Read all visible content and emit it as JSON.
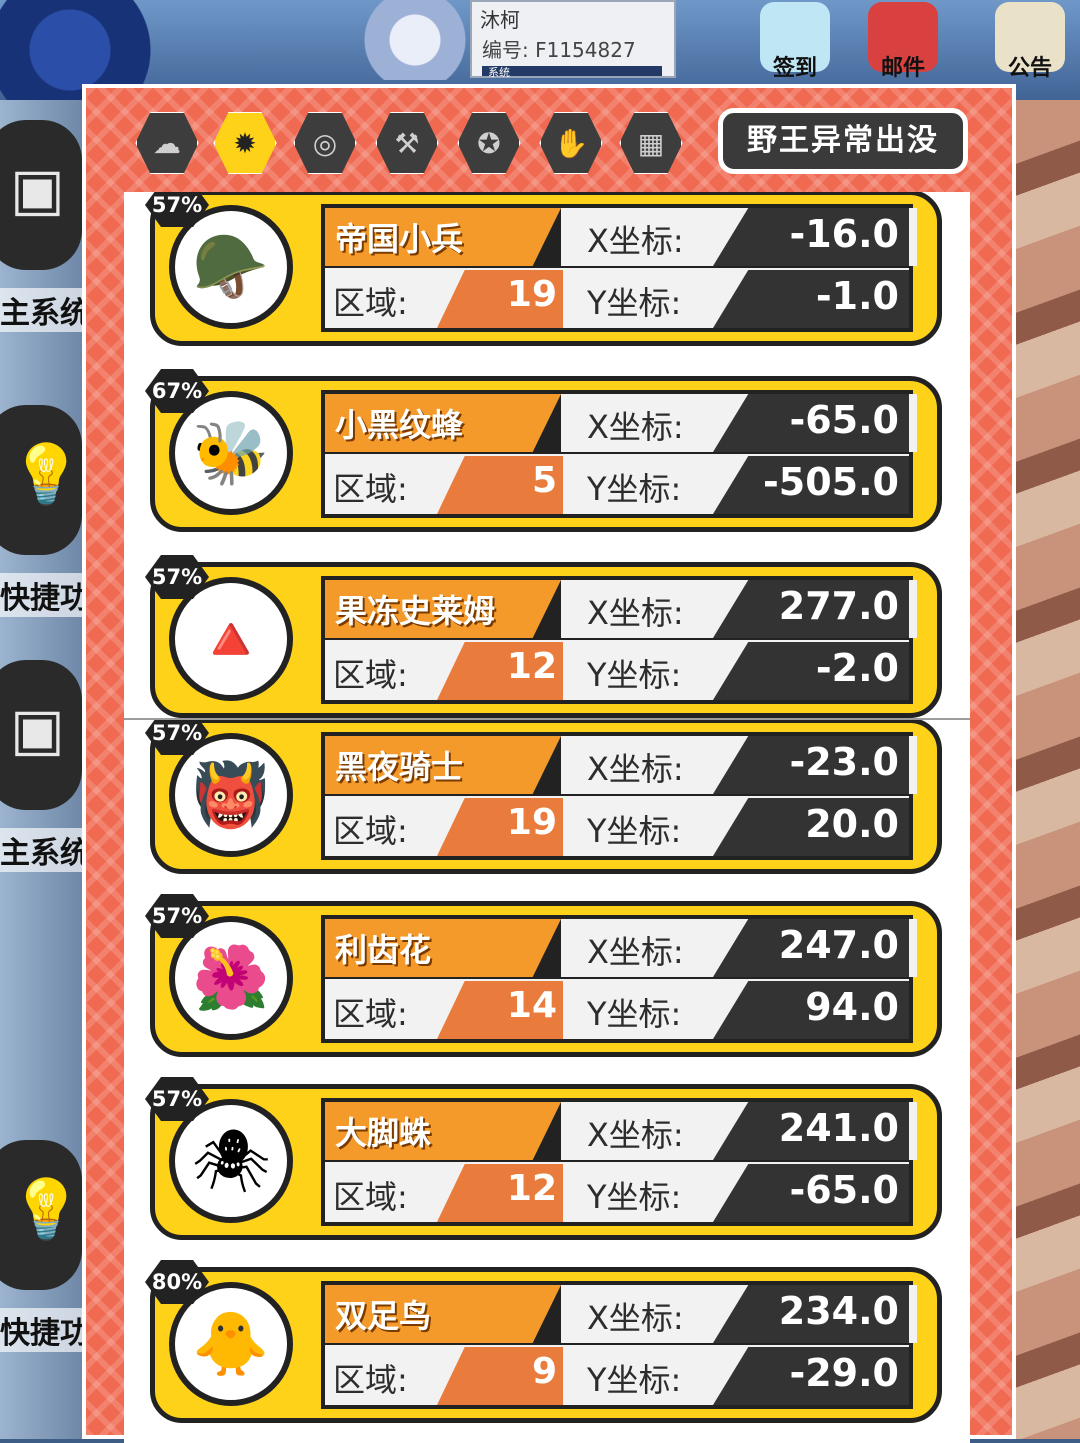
{
  "background": {
    "profile": {
      "name": "沐柯",
      "id_label": "编号: F1154827",
      "bar_label": "系统"
    },
    "top_icons": [
      {
        "label": "签到",
        "icon": "avatar-icon"
      },
      {
        "label": "邮件",
        "icon": "mail-icon"
      },
      {
        "label": "公告",
        "icon": "notice-icon"
      }
    ],
    "side_labels": [
      "主系统",
      "快捷功能",
      "主系统",
      "快捷功能"
    ]
  },
  "tabs": [
    {
      "icon": "fire-icon",
      "glyph": "☁",
      "active": false
    },
    {
      "icon": "flame-burst-icon",
      "glyph": "✹",
      "active": true
    },
    {
      "icon": "coins-icon",
      "glyph": "◎",
      "active": false
    },
    {
      "icon": "hammer-icon",
      "glyph": "⚒",
      "active": false
    },
    {
      "icon": "badge-icon",
      "glyph": "✪",
      "active": false
    },
    {
      "icon": "hand-icon",
      "glyph": "✋",
      "active": false
    },
    {
      "icon": "grid-icon",
      "glyph": "▦",
      "active": false
    }
  ],
  "title_button": "野王异常出没",
  "labels": {
    "x": "X坐标:",
    "y": "Y坐标:",
    "zone": "区域:"
  },
  "list_top": [
    {
      "pct": "57%",
      "name": "帝国小兵",
      "zone": "19",
      "x": "-16.0",
      "y": "-1.0",
      "icon": "soldier-icon",
      "glyph": "🪖"
    },
    {
      "pct": "67%",
      "name": "小黑纹蜂",
      "zone": "5",
      "x": "-65.0",
      "y": "-505.0",
      "icon": "bee-icon",
      "glyph": "🐝"
    },
    {
      "pct": "57%",
      "name": "果冻史莱姆",
      "zone": "12",
      "x": "277.0",
      "y": "-2.0",
      "icon": "slime-icon",
      "glyph": "🔺"
    }
  ],
  "list_bottom": [
    {
      "pct": "57%",
      "name": "黑夜骑士",
      "zone": "19",
      "x": "-23.0",
      "y": "20.0",
      "icon": "knight-icon",
      "glyph": "👹"
    },
    {
      "pct": "57%",
      "name": "利齿花",
      "zone": "14",
      "x": "247.0",
      "y": "94.0",
      "icon": "flower-icon",
      "glyph": "🌺"
    },
    {
      "pct": "57%",
      "name": "大脚蛛",
      "zone": "12",
      "x": "241.0",
      "y": "-65.0",
      "icon": "spider-icon",
      "glyph": "🕷"
    },
    {
      "pct": "80%",
      "name": "双足鸟",
      "zone": "9",
      "x": "234.0",
      "y": "-29.0",
      "icon": "bird-icon",
      "glyph": "🐥"
    }
  ]
}
